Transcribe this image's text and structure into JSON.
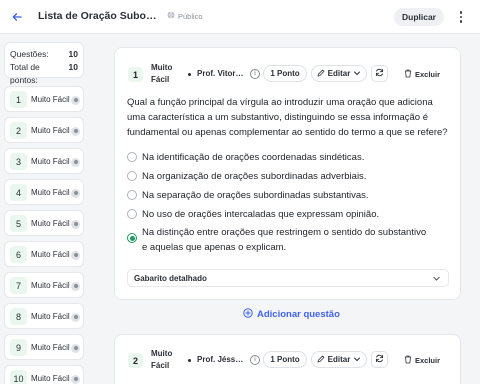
{
  "header": {
    "title": "Lista de Oração Subordinada",
    "visibility": "Público",
    "duplicate_label": "Duplicar"
  },
  "summary": {
    "questions_label": "Questões:",
    "questions_value": "10",
    "points_label": "Total de pontos:",
    "points_value": "10"
  },
  "sidebar": {
    "items": [
      {
        "num": "1",
        "difficulty": "Muito Fácil"
      },
      {
        "num": "2",
        "difficulty": "Muito Fácil"
      },
      {
        "num": "3",
        "difficulty": "Muito Fácil"
      },
      {
        "num": "4",
        "difficulty": "Muito Fácil"
      },
      {
        "num": "5",
        "difficulty": "Muito Fácil"
      },
      {
        "num": "6",
        "difficulty": "Muito Fácil"
      },
      {
        "num": "7",
        "difficulty": "Muito Fácil"
      },
      {
        "num": "8",
        "difficulty": "Muito Fácil"
      },
      {
        "num": "9",
        "difficulty": "Muito Fácil"
      },
      {
        "num": "10",
        "difficulty": "Muito Fácil"
      }
    ]
  },
  "questions": [
    {
      "num": "1",
      "difficulty": "Muito Fácil",
      "author": "Prof. Vitor Sousa",
      "points": "1 Ponto",
      "edit_label": "Editar",
      "delete_label": "Excluir",
      "text": "Qual a função principal da vírgula ao introduzir uma oração que adiciona uma característica a um substantivo, distinguindo se essa informação é fundamental ou apenas complementar ao sentido do termo a que se refere?",
      "options": [
        "Na identificação de orações coordenadas sindéticas.",
        "Na organização de orações subordinadas adverbiais.",
        "Na separação de orações subordinadas substantivas.",
        "No uso de orações intercaladas que expressam opinião.",
        "Na distinção entre orações que restringem o sentido do substantivo e aquelas que apenas o explicam."
      ],
      "selected_option": 4,
      "answer_label": "Gabarito detalhado"
    },
    {
      "num": "2",
      "difficulty": "Muito Fácil",
      "author": "Prof. Jéssica Lima",
      "points": "1 Ponto",
      "edit_label": "Editar",
      "delete_label": "Excluir"
    }
  ],
  "add_question_label": "Adicionar questão",
  "colors": {
    "accent": "#4263eb",
    "selected": "#1c9a61",
    "badge_bg": "#e9f7ef"
  }
}
